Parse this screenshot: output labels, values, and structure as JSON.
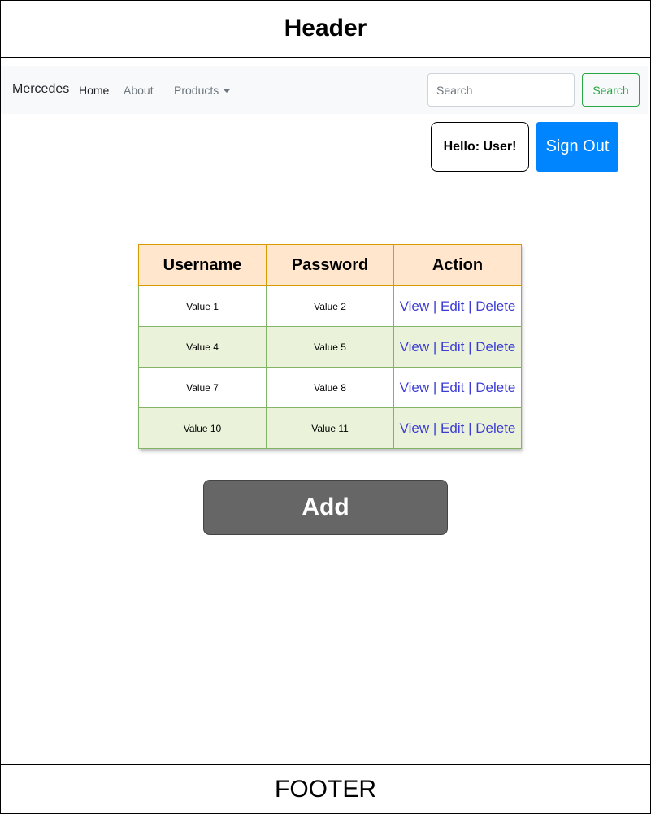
{
  "header": {
    "title": "Header"
  },
  "navbar": {
    "brand": "Mercedes",
    "links": [
      {
        "label": "Home"
      },
      {
        "label": "About"
      },
      {
        "label": "Products"
      }
    ],
    "search": {
      "placeholder": "Search",
      "value": "",
      "button_label": "Search"
    }
  },
  "user": {
    "greeting": "Hello: User!",
    "signout_label": "Sign Out"
  },
  "table": {
    "headers": [
      "Username",
      "Password",
      "Action"
    ],
    "rows": [
      [
        "Value 1",
        "Value 2"
      ],
      [
        "Value 4",
        "Value 5"
      ],
      [
        "Value 7",
        "Value 8"
      ],
      [
        "Value 10",
        "Value 11"
      ]
    ],
    "actions": {
      "view": "View",
      "edit": "Edit",
      "delete": "Delete",
      "separator": "|"
    }
  },
  "add_button": {
    "label": "Add"
  },
  "footer": {
    "text": "FOOTER"
  },
  "colors": {
    "header_fill": "#ffe6cc",
    "header_border": "#d79b00",
    "row_alt_fill": "#eaf3d9",
    "row_border": "#82b366",
    "link": "#3d3dd6",
    "signout": "#0085ff",
    "search_button": "#28a745",
    "add_button": "#666666"
  }
}
